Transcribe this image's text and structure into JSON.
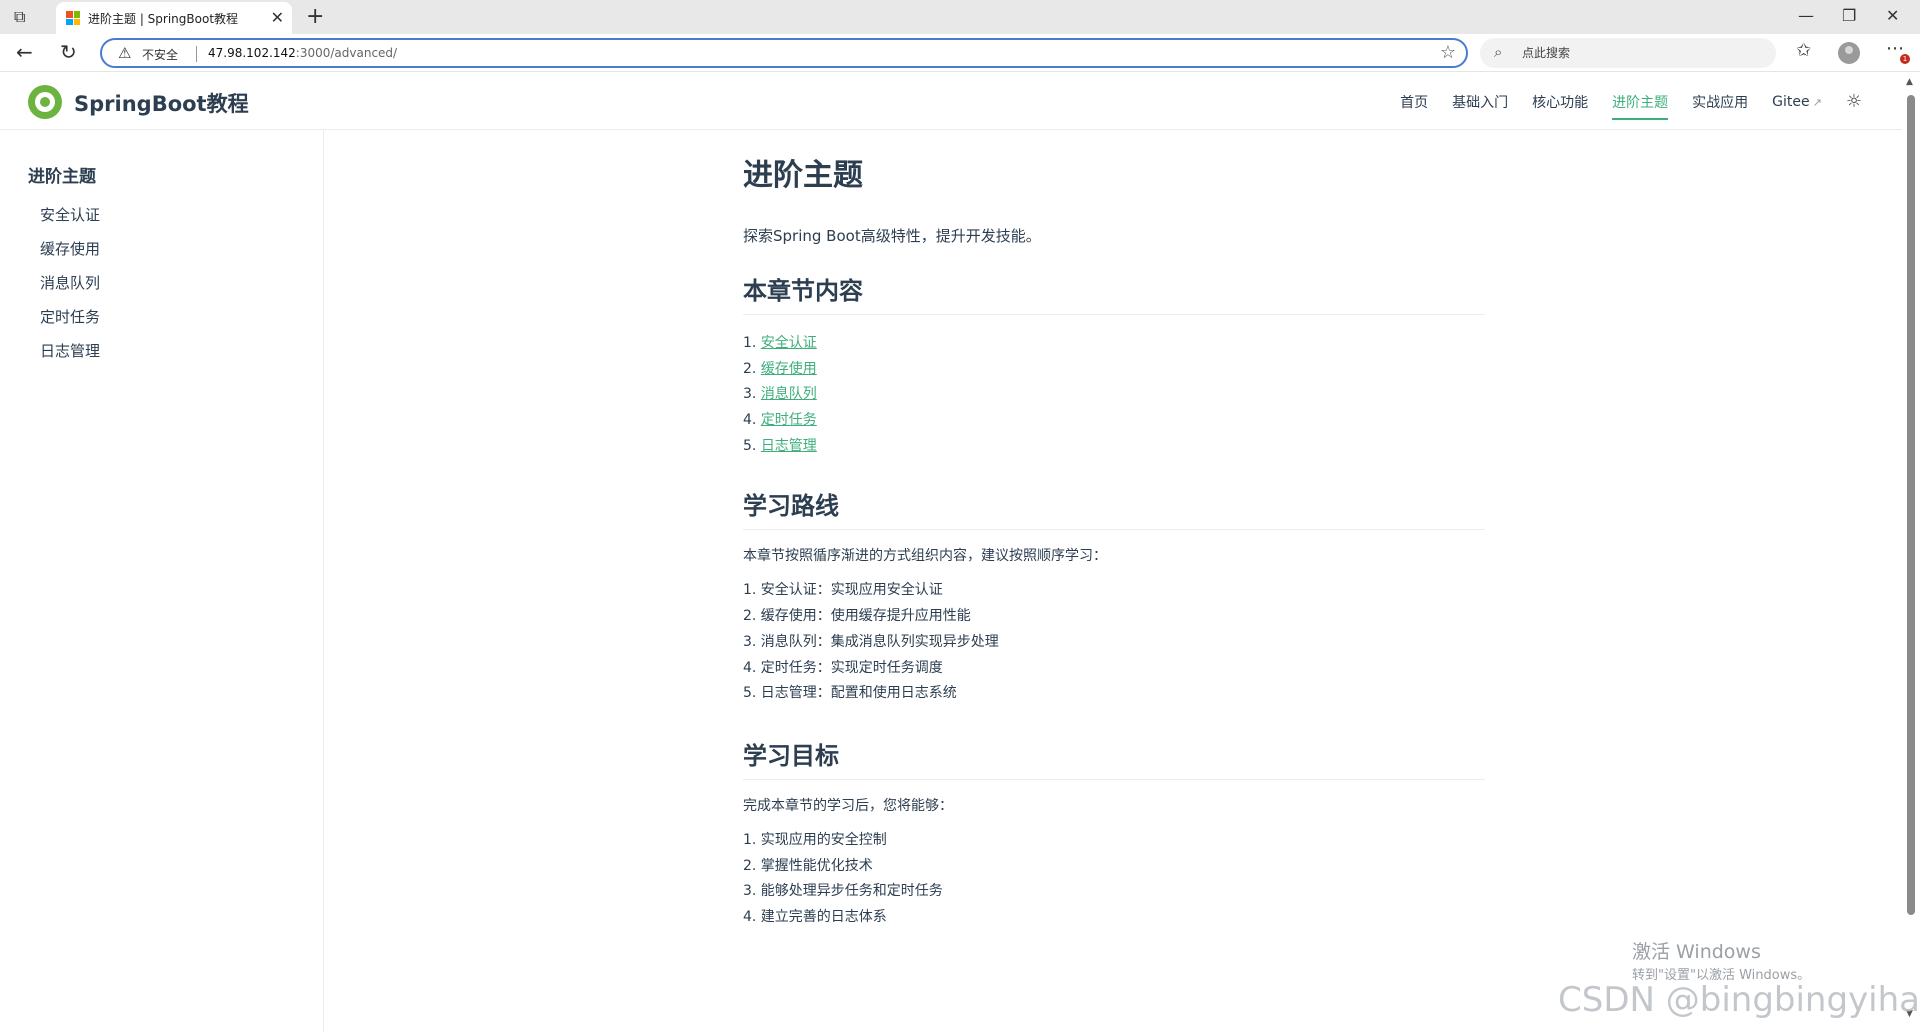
{
  "browser": {
    "tab_title": "进阶主题 | SpringBoot教程",
    "address_security_label": "不安全",
    "url_host": "47.98.102.142",
    "url_rest": ":3000/advanced/",
    "search_placeholder": "点此搜索",
    "notification_count": "1"
  },
  "site": {
    "title": "SpringBoot教程",
    "accent_color": "#3eaf7c",
    "logo_color": "#6db33f",
    "nav": [
      {
        "label": "首页"
      },
      {
        "label": "基础入门"
      },
      {
        "label": "核心功能"
      },
      {
        "label": "进阶主题",
        "active": true
      },
      {
        "label": "实战应用"
      },
      {
        "label": "Gitee"
      }
    ]
  },
  "sidebar": {
    "heading": "进阶主题",
    "items": [
      "安全认证",
      "缓存使用",
      "消息队列",
      "定时任务",
      "日志管理"
    ]
  },
  "content": {
    "title": "进阶主题",
    "intro": "探索Spring Boot高级特性，提升开发技能。",
    "toc_heading": "本章节内容",
    "toc": [
      {
        "num": "1.",
        "label": "安全认证"
      },
      {
        "num": "2.",
        "label": "缓存使用"
      },
      {
        "num": "3.",
        "label": "消息队列"
      },
      {
        "num": "4.",
        "label": "定时任务"
      },
      {
        "num": "5.",
        "label": "日志管理"
      }
    ],
    "path_heading": "学习路线",
    "path_intro": "本章节按照循序渐进的方式组织内容，建议按照顺序学习：",
    "path": [
      "1. 安全认证：实现应用安全认证",
      "2. 缓存使用：使用缓存提升应用性能",
      "3. 消息队列：集成消息队列实现异步处理",
      "4. 定时任务：实现定时任务调度",
      "5. 日志管理：配置和使用日志系统"
    ],
    "goals_heading": "学习目标",
    "goals_intro": "完成本章节的学习后，您将能够：",
    "goals": [
      "1. 实现应用的安全控制",
      "2. 掌握性能优化技术",
      "3. 能够处理异步任务和定时任务",
      "4. 建立完善的日志体系"
    ]
  },
  "overlay": {
    "activation_title": "激活 Windows",
    "activation_sub": "转到\"设置\"以激活 Windows。",
    "watermark": "CSDN @bingbingyihao"
  }
}
